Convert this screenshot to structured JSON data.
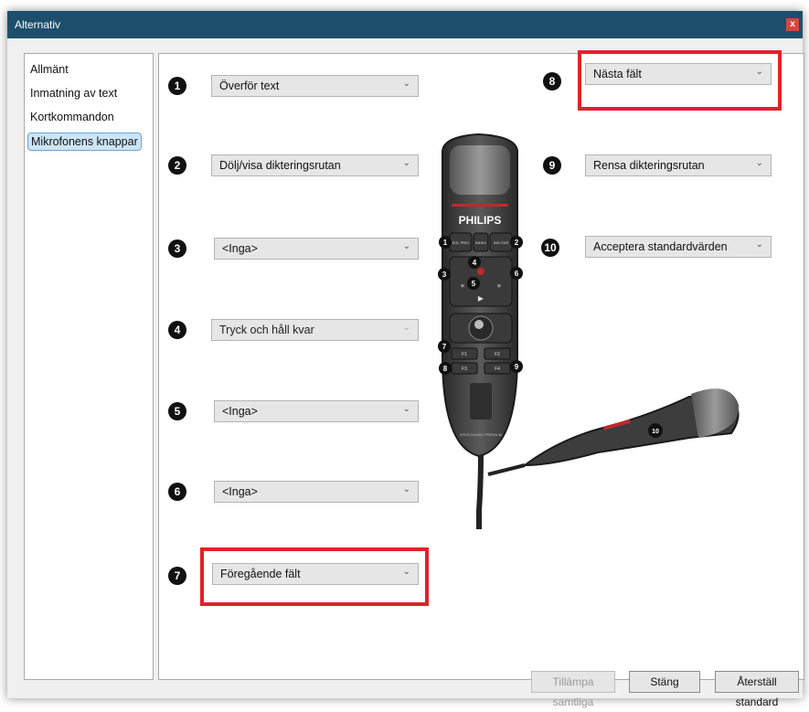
{
  "window": {
    "title": "Alternativ",
    "close": "x"
  },
  "sidebar": {
    "items": [
      {
        "label": "Allmänt"
      },
      {
        "label": "Inmatning av text"
      },
      {
        "label": "Kortkommandon"
      },
      {
        "label": "Mikrofonens knappar"
      }
    ],
    "selected": "Mikrofonens knappar"
  },
  "buttons": [
    {
      "n": "1",
      "value": "Överför text",
      "disabled": false
    },
    {
      "n": "2",
      "value": "Dölj/visa dikteringsrutan",
      "disabled": false
    },
    {
      "n": "3",
      "value": "<Inga>",
      "disabled": false
    },
    {
      "n": "4",
      "value": "Tryck och håll kvar",
      "disabled": true
    },
    {
      "n": "5",
      "value": "<Inga>",
      "disabled": false
    },
    {
      "n": "6",
      "value": "<Inga>",
      "disabled": false
    },
    {
      "n": "7",
      "value": "Föregående fält",
      "disabled": false
    },
    {
      "n": "8",
      "value": "Nästa fält",
      "disabled": false
    },
    {
      "n": "9",
      "value": "Rensa dikteringsrutan",
      "disabled": false
    },
    {
      "n": "10",
      "value": "Acceptera standardvärden",
      "disabled": false
    }
  ],
  "microphone": {
    "brand": "PHILIPS",
    "model_text": "SPEECHMIKE PREMIUM",
    "key_labels": [
      "EOL PRIO",
      "INS OVR",
      "INDEX",
      "F1",
      "F2",
      "F3",
      "F4"
    ]
  },
  "footer": {
    "apply_all": "Tillämpa samtliga",
    "close": "Stäng",
    "reset": "Återställ standard"
  },
  "colors": {
    "titlebar": "#1d4e6b",
    "highlight": "#e3202a",
    "close_button": "#d9463a",
    "selected_item": "#cce4f7"
  }
}
